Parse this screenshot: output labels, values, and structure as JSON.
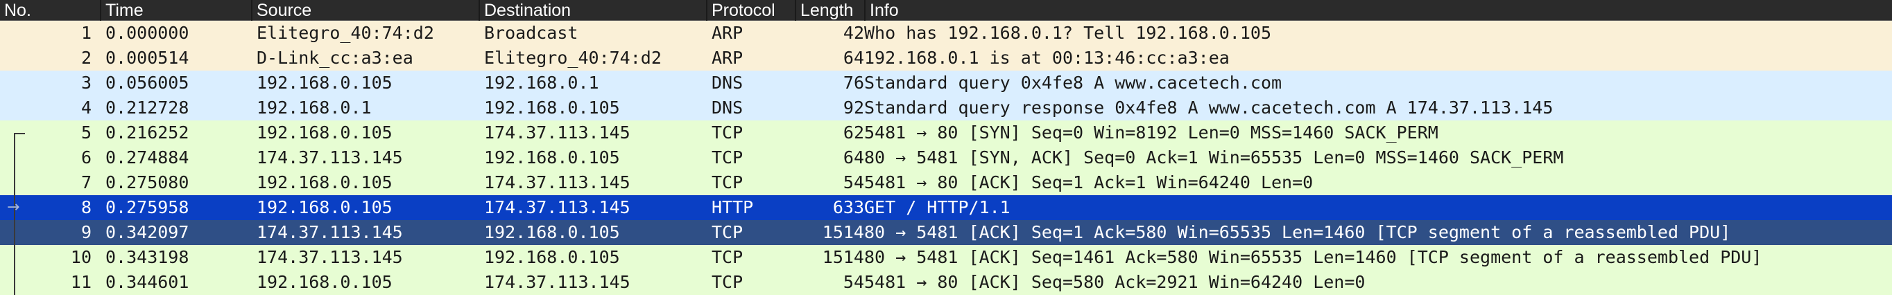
{
  "columns": {
    "no": "No.",
    "time": "Time",
    "source": "Source",
    "destination": "Destination",
    "protocol": "Protocol",
    "length": "Length",
    "info": "Info"
  },
  "colors": {
    "header_bg": "#2b2b2b",
    "arp": "#faf0d7",
    "dns": "#daeeff",
    "tcp": "#e7fdd3",
    "selected_bg": "#0a3fc4",
    "secondary_bg": "#2f4f86",
    "selected_text": "#ffffff"
  },
  "packets": [
    {
      "no": "1",
      "time": "0.000000",
      "source": "Elitegro_40:74:d2",
      "destination": "Broadcast",
      "protocol": "ARP",
      "length": "42",
      "info": "Who has 192.168.0.1? Tell 192.168.0.105",
      "color": "arp",
      "state": "normal"
    },
    {
      "no": "2",
      "time": "0.000514",
      "source": "D-Link_cc:a3:ea",
      "destination": "Elitegro_40:74:d2",
      "protocol": "ARP",
      "length": "64",
      "info": "192.168.0.1 is at 00:13:46:cc:a3:ea",
      "color": "arp",
      "state": "normal"
    },
    {
      "no": "3",
      "time": "0.056005",
      "source": "192.168.0.105",
      "destination": "192.168.0.1",
      "protocol": "DNS",
      "length": "76",
      "info": "Standard query 0x4fe8 A www.cacetech.com",
      "color": "dns",
      "state": "normal"
    },
    {
      "no": "4",
      "time": "0.212728",
      "source": "192.168.0.1",
      "destination": "192.168.0.105",
      "protocol": "DNS",
      "length": "92",
      "info": "Standard query response 0x4fe8 A www.cacetech.com A 174.37.113.145",
      "color": "dns",
      "state": "normal"
    },
    {
      "no": "5",
      "time": "0.216252",
      "source": "192.168.0.105",
      "destination": "174.37.113.145",
      "protocol": "TCP",
      "length": "62",
      "info": "5481 → 80 [SYN] Seq=0 Win=8192 Len=0 MSS=1460 SACK_PERM",
      "color": "tcp",
      "state": "normal"
    },
    {
      "no": "6",
      "time": "0.274884",
      "source": "174.37.113.145",
      "destination": "192.168.0.105",
      "protocol": "TCP",
      "length": "64",
      "info": "80 → 5481 [SYN, ACK] Seq=0 Ack=1 Win=65535 Len=0 MSS=1460 SACK_PERM",
      "color": "tcp",
      "state": "normal"
    },
    {
      "no": "7",
      "time": "0.275080",
      "source": "192.168.0.105",
      "destination": "174.37.113.145",
      "protocol": "TCP",
      "length": "54",
      "info": "5481 → 80 [ACK] Seq=1 Ack=1 Win=64240 Len=0",
      "color": "tcp",
      "state": "normal"
    },
    {
      "no": "8",
      "time": "0.275958",
      "source": "192.168.0.105",
      "destination": "174.37.113.145",
      "protocol": "HTTP",
      "length": "633",
      "info": "GET / HTTP/1.1",
      "color": "tcp",
      "state": "selected"
    },
    {
      "no": "9",
      "time": "0.342097",
      "source": "174.37.113.145",
      "destination": "192.168.0.105",
      "protocol": "TCP",
      "length": "1514",
      "info": "80 → 5481 [ACK] Seq=1 Ack=580 Win=65535 Len=1460 [TCP segment of a reassembled PDU]",
      "color": "tcp",
      "state": "related"
    },
    {
      "no": "10",
      "time": "0.343198",
      "source": "174.37.113.145",
      "destination": "192.168.0.105",
      "protocol": "TCP",
      "length": "1514",
      "info": "80 → 5481 [ACK] Seq=1461 Ack=580 Win=65535 Len=1460 [TCP segment of a reassembled PDU]",
      "color": "tcp",
      "state": "normal"
    },
    {
      "no": "11",
      "time": "0.344601",
      "source": "192.168.0.105",
      "destination": "174.37.113.145",
      "protocol": "TCP",
      "length": "54",
      "info": "5481 → 80 [ACK] Seq=580 Ack=2921 Win=64240 Len=0",
      "color": "tcp",
      "state": "normal"
    }
  ]
}
